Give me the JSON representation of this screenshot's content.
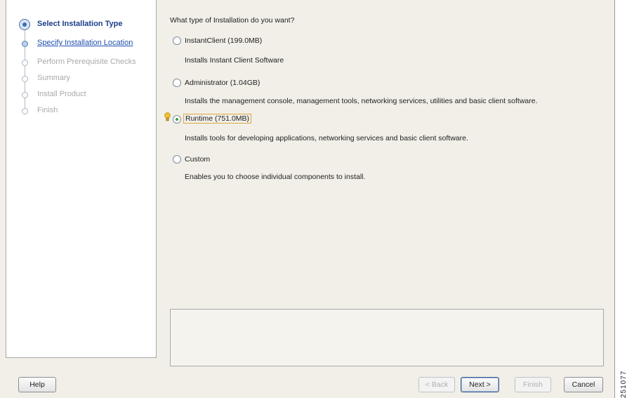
{
  "steps": [
    {
      "label": "Select Installation Type",
      "state": "current"
    },
    {
      "label": "Specify Installation Location",
      "state": "link"
    },
    {
      "label": "Perform Prerequisite Checks",
      "state": "disabled"
    },
    {
      "label": "Summary",
      "state": "disabled"
    },
    {
      "label": "Install Product",
      "state": "disabled"
    },
    {
      "label": "Finish",
      "state": "disabled"
    }
  ],
  "content": {
    "question": "What type of Installation do you want?",
    "options": [
      {
        "label": "InstantClient (199.0MB)",
        "description": "Installs Instant Client Software",
        "selected": false
      },
      {
        "label": "Administrator (1.04GB)",
        "description": "Installs the management console, management tools, networking services, utilities and basic client software.",
        "selected": false
      },
      {
        "label": "Runtime (751.0MB)",
        "description": "Installs tools for developing applications, networking services and basic client software.",
        "selected": true
      },
      {
        "label": "Custom",
        "description": "Enables you to choose individual components to install.",
        "selected": false
      }
    ]
  },
  "buttons": {
    "help": "Help",
    "back": "< Back",
    "next": "Next >",
    "finish": "Finish",
    "cancel": "Cancel"
  },
  "figure_id": "251077"
}
